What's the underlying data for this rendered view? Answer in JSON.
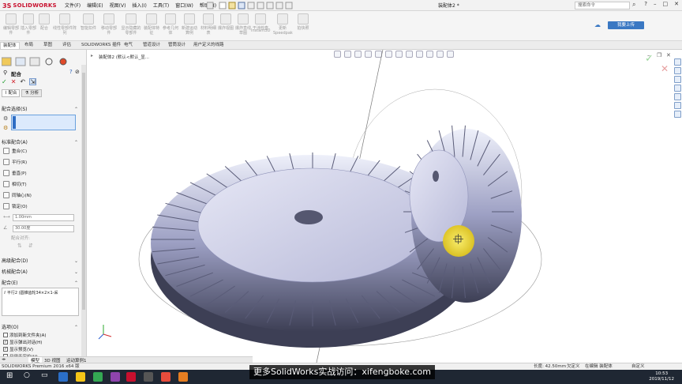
{
  "titlebar": {
    "logo_ds": "3S",
    "logo_sw": "SOLIDWORKS",
    "menus": [
      "文件(F)",
      "编辑(E)",
      "视图(V)",
      "插入(I)",
      "工具(T)",
      "窗口(W)",
      "帮助(H)"
    ],
    "doc_title": "装配体2 *",
    "search_placeholder": "搜索命令",
    "window_controls": [
      "?",
      "–",
      "□",
      "✕"
    ]
  },
  "cmdbar": {
    "items": [
      "编辑零部件",
      "插入零部件",
      "配合",
      "线性零部件阵列",
      "智能扣件",
      "移动零部件",
      "显示隐藏的零部件",
      "装配体特征",
      "参考几何体",
      "新建运动算例",
      "材料明细表",
      "爆炸视图",
      "爆炸直线草图",
      "干涉检查",
      "Instant3D",
      "更新Speedpak",
      "拍快照"
    ],
    "cloud_button": "我要上传"
  },
  "tabs": [
    "装配体",
    "布局",
    "草图",
    "评估",
    "SOLIDWORKS 插件",
    "电气",
    "管道设计",
    "管筒设计",
    "用户定义的线路"
  ],
  "active_tab_index": 0,
  "left_panel": {
    "title": "配合",
    "subtabs": [
      "配合",
      "分析"
    ],
    "sections": {
      "mate_selection": "配合选择(S)",
      "standard_mates": "标准配合(A)",
      "advanced_mates": "高级配合(D)",
      "mechanical_mates": "机械配合(A)",
      "mates": "配合(E)",
      "options": "选项(O)"
    },
    "standard_options": [
      "重合(C)",
      "平行(R)",
      "垂直(P)",
      "相切(T)",
      "同轴心(N)",
      "锁定(O)"
    ],
    "distance_value": "1.00mm",
    "angle_value": "30.00度",
    "mate_alignment": "配合对齐:",
    "mate_list_item": "平行2 (圆锥齿轮34×2×1-采",
    "option_checks": [
      {
        "label": "添加到新文件夹(A)",
        "checked": false
      },
      {
        "label": "显示弹出对话(H)",
        "checked": true
      },
      {
        "label": "显示预览(V)",
        "checked": true
      },
      {
        "label": "只用于定位(U)",
        "checked": false
      }
    ]
  },
  "viewport": {
    "breadcrumb": "装配体2 (默认<默认_显..."
  },
  "bottom_tabs": [
    "模型",
    "3D 视图",
    "运动算例1"
  ],
  "statusbar": {
    "product": "SOLIDWORKS Premium 2016 x64 版",
    "length": "长度: 42.50mm",
    "state": "欠定义",
    "editing": "在编辑 装配体",
    "custom": "自定义"
  },
  "watermark": "更多SolidWorks实战访问：xifengboke.com",
  "clock": {
    "time": "10:53",
    "date": "2019/11/12"
  },
  "colors": {
    "brand_red": "#c8102e",
    "gear_face": "#c9cbe6",
    "gear_dark": "#3d3f55",
    "cursor_highlight": "#f2dc2a",
    "taskbar": "#1f2733"
  }
}
